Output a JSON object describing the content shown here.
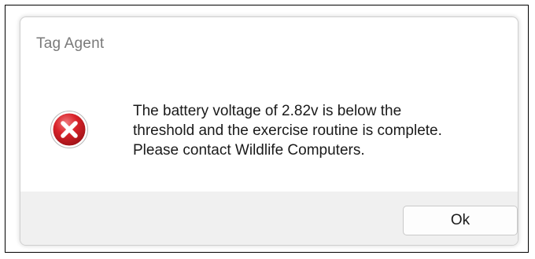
{
  "window": {
    "title": "Tag Agent"
  },
  "message": {
    "icon": "error-icon",
    "lines": [
      "The battery voltage of 2.82v is below the",
      "threshold and the exercise routine is complete.",
      "Please contact Wildlife Computers."
    ]
  },
  "buttons": {
    "ok_label": "Ok"
  },
  "colors": {
    "error_red": "#d9232a",
    "footer_bg": "#f0f0f0"
  }
}
